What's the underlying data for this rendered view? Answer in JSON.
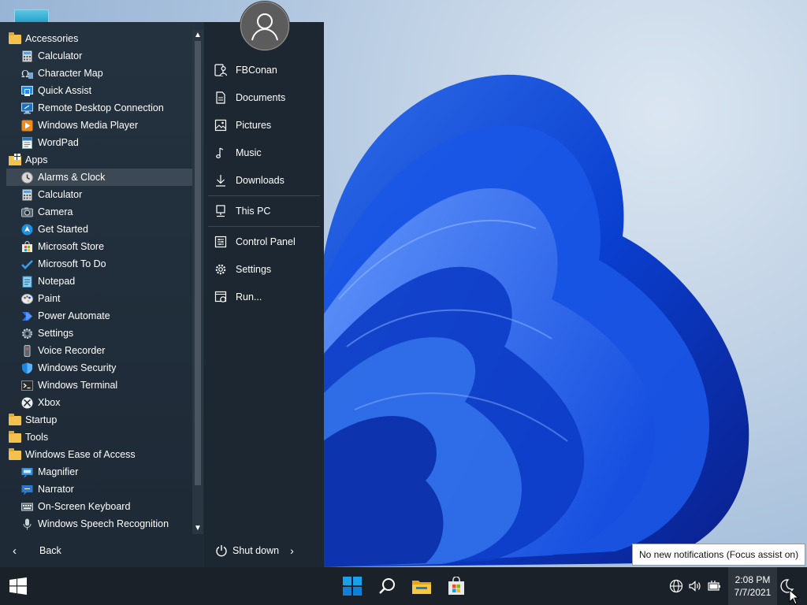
{
  "start_menu": {
    "programs": [
      {
        "label": "Accessories",
        "kind": "folder",
        "icon": "folder-icon"
      },
      {
        "label": "Calculator",
        "kind": "child",
        "icon": "calculator-icon"
      },
      {
        "label": "Character Map",
        "kind": "child",
        "icon": "character-map-icon"
      },
      {
        "label": "Quick Assist",
        "kind": "child",
        "icon": "quick-assist-icon"
      },
      {
        "label": "Remote Desktop Connection",
        "kind": "child",
        "icon": "remote-desktop-icon"
      },
      {
        "label": "Windows Media Player",
        "kind": "child",
        "icon": "media-player-icon"
      },
      {
        "label": "WordPad",
        "kind": "child",
        "icon": "wordpad-icon"
      },
      {
        "label": "Apps",
        "kind": "folder",
        "icon": "apps-folder-icon"
      },
      {
        "label": "Alarms & Clock",
        "kind": "child",
        "icon": "alarms-clock-icon",
        "selected": true
      },
      {
        "label": "Calculator",
        "kind": "child",
        "icon": "calculator-icon"
      },
      {
        "label": "Camera",
        "kind": "child",
        "icon": "camera-icon"
      },
      {
        "label": "Get Started",
        "kind": "child",
        "icon": "get-started-icon"
      },
      {
        "label": "Microsoft Store",
        "kind": "child",
        "icon": "store-icon"
      },
      {
        "label": "Microsoft To Do",
        "kind": "child",
        "icon": "todo-check-icon"
      },
      {
        "label": "Notepad",
        "kind": "child",
        "icon": "notepad-icon"
      },
      {
        "label": "Paint",
        "kind": "child",
        "icon": "paint-icon"
      },
      {
        "label": "Power Automate",
        "kind": "child",
        "icon": "power-automate-icon"
      },
      {
        "label": "Settings",
        "kind": "child",
        "icon": "settings-gear-icon"
      },
      {
        "label": "Voice Recorder",
        "kind": "child",
        "icon": "voice-recorder-icon"
      },
      {
        "label": "Windows Security",
        "kind": "child",
        "icon": "shield-icon"
      },
      {
        "label": "Windows Terminal",
        "kind": "child",
        "icon": "terminal-icon"
      },
      {
        "label": "Xbox",
        "kind": "child",
        "icon": "xbox-icon"
      },
      {
        "label": "Startup",
        "kind": "folder",
        "icon": "folder-icon"
      },
      {
        "label": "Tools",
        "kind": "folder",
        "icon": "folder-icon"
      },
      {
        "label": "Windows Ease of Access",
        "kind": "folder",
        "icon": "folder-icon"
      },
      {
        "label": "Magnifier",
        "kind": "child",
        "icon": "magnifier-icon"
      },
      {
        "label": "Narrator",
        "kind": "child",
        "icon": "narrator-icon"
      },
      {
        "label": "On-Screen Keyboard",
        "kind": "child",
        "icon": "keyboard-icon"
      },
      {
        "label": "Windows Speech Recognition",
        "kind": "child",
        "icon": "microphone-icon"
      }
    ],
    "back_label": "Back",
    "places": [
      {
        "label": "FBConan",
        "icon": "user-icon"
      },
      {
        "label": "Documents",
        "icon": "document-icon"
      },
      {
        "label": "Pictures",
        "icon": "pictures-icon"
      },
      {
        "label": "Music",
        "icon": "music-note-icon"
      },
      {
        "label": "Downloads",
        "icon": "download-arrow-icon"
      },
      {
        "label": "This PC",
        "icon": "computer-icon"
      },
      {
        "label": "Control Panel",
        "icon": "control-panel-icon"
      },
      {
        "label": "Settings",
        "icon": "gear-icon"
      },
      {
        "label": "Run...",
        "icon": "run-icon"
      }
    ],
    "shutdown_label": "Shut down"
  },
  "notification_tooltip": "No new notifications (Focus assist on)",
  "clock": {
    "time": "2:08 PM",
    "date": "7/7/2021"
  },
  "colors": {
    "accent": "#0f7fd8",
    "folder": "#f2c14e",
    "taskbar": "#1b2128"
  }
}
